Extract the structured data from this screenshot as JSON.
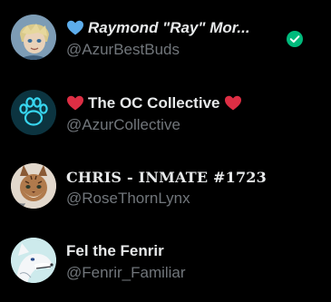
{
  "accounts": [
    {
      "display_name": "Raymond \"Ray\" Mor...",
      "handle": "@AzurBestBuds",
      "name_prefix_icon": "blue-heart-icon",
      "verified_icon": "verified-check-icon",
      "avatar": "blonde-cartoon-character-avatar"
    },
    {
      "display_name": "The OC Collective",
      "handle": "@AzurCollective",
      "name_prefix_icon": "red-heart-icon",
      "name_suffix_icon": "red-heart-icon",
      "avatar": "neon-paw-print-avatar"
    },
    {
      "display_name": "CHRIS - INMATE #1723",
      "handle": "@RoseThornLynx",
      "avatar": "lynx-character-avatar"
    },
    {
      "display_name": "Fel the Fenrir",
      "handle": "@Fenrir_Familiar",
      "avatar": "white-wolf-avatar"
    }
  ],
  "colors": {
    "background": "#000000",
    "name_text": "#e7e9ea",
    "handle_text": "#71767b",
    "verified_green": "#00ba7c",
    "blue_heart": "#5dadec",
    "red_heart": "#dd2e44"
  }
}
